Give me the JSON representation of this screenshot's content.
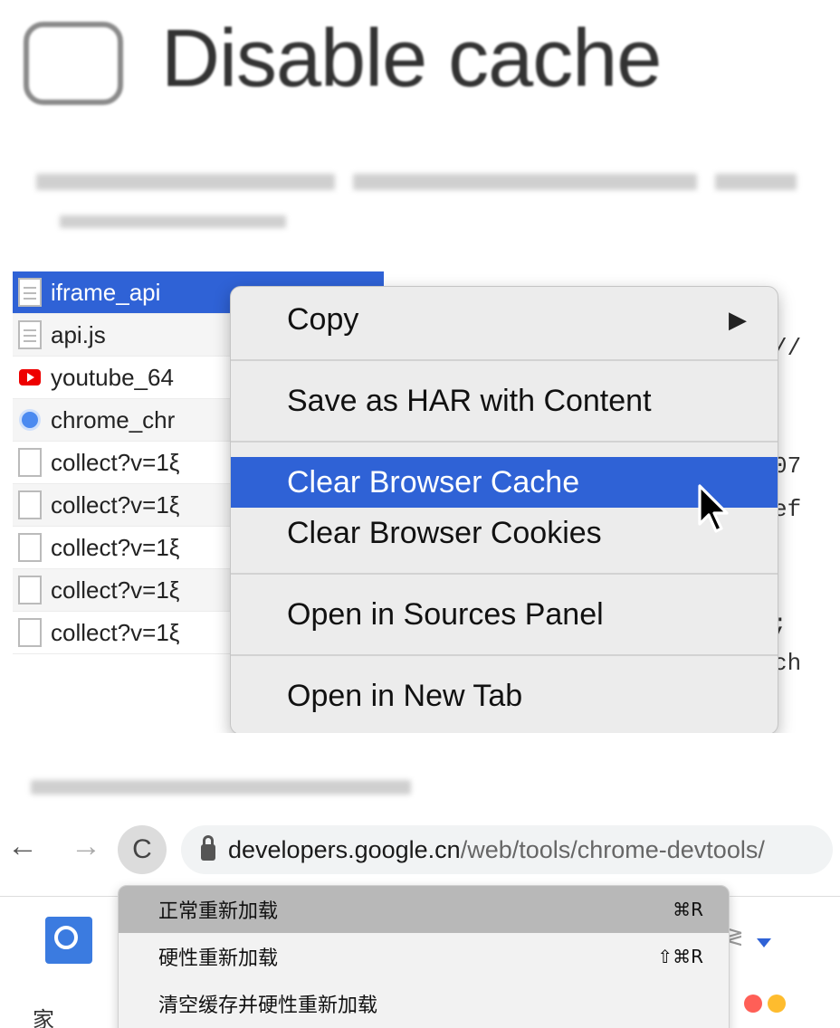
{
  "disable_cache": {
    "label": "Disable cache"
  },
  "network": {
    "requests": [
      {
        "name": "iframe_api",
        "icon": "document-icon",
        "selected": true
      },
      {
        "name": "api.js",
        "icon": "document-icon"
      },
      {
        "name": "youtube_64",
        "icon": "youtube-icon"
      },
      {
        "name": "chrome_chr",
        "icon": "chrome-icon"
      },
      {
        "name": "collect?v=1ξ",
        "icon": "blank-file-icon"
      },
      {
        "name": "collect?v=1ξ",
        "icon": "blank-file-icon"
      },
      {
        "name": "collect?v=1ξ",
        "icon": "blank-file-icon"
      },
      {
        "name": "collect?v=1ξ",
        "icon": "blank-file-icon"
      },
      {
        "name": "collect?v=1ξ",
        "icon": "blank-file-icon"
      }
    ],
    "code_fragments": [
      "//",
      "07",
      "ef",
      ";",
      "ch"
    ],
    "context_menu": {
      "items": [
        {
          "label": "Copy",
          "submenu_arrow": "▶"
        },
        {
          "label": "Save as HAR with Content"
        },
        {
          "label": "Clear Browser Cache"
        },
        {
          "label": "Clear Browser Cookies"
        },
        {
          "label": "Open in Sources Panel"
        },
        {
          "label": "Open in New Tab"
        }
      ]
    }
  },
  "browser": {
    "back": "←",
    "forward": "→",
    "reload": "C",
    "url_host": "developers.google.cn",
    "url_path": "/web/tools/chrome-devtools/",
    "reload_menu": {
      "items": [
        {
          "label": "正常重新加载",
          "shortcut": "⌘R"
        },
        {
          "label": "硬性重新加载",
          "shortcut": "⇧⌘R"
        },
        {
          "label": "清空缓存并硬性重新加载",
          "shortcut": ""
        }
      ]
    },
    "home_fragment": "家",
    "right_fragment": "≷"
  },
  "colors": {
    "selection_blue": "#2f62d6",
    "menu_bg": "#ececec",
    "reload_hover": "#b8b8b8"
  }
}
